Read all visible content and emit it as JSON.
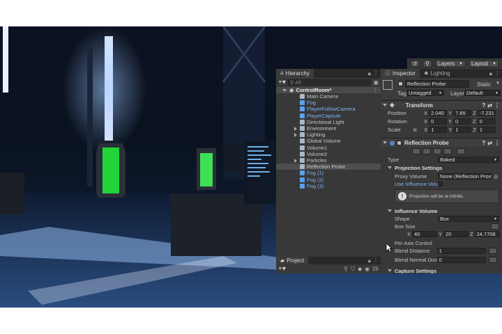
{
  "toolbar": {
    "layers_label": "Layers",
    "layout_label": "Layout"
  },
  "hierarchy": {
    "tab_label": "Hierarchy",
    "search_placeholder": "All",
    "scene_root": "ControlRoom*",
    "items": [
      {
        "label": "Main Camera",
        "prefab": false
      },
      {
        "label": "Fog",
        "prefab": true
      },
      {
        "label": "PlayerFollowCamera",
        "prefab": true
      },
      {
        "label": "PlayerCapsule",
        "prefab": true
      },
      {
        "label": "Directional Light",
        "prefab": false
      },
      {
        "label": "Environment",
        "prefab": false
      },
      {
        "label": "Lighting",
        "prefab": false
      },
      {
        "label": "Global Volume",
        "prefab": false
      },
      {
        "label": "Volume1",
        "prefab": false
      },
      {
        "label": "Volume2",
        "prefab": false
      },
      {
        "label": "Particles",
        "prefab": false
      },
      {
        "label": "Reflection Probe",
        "prefab": false
      },
      {
        "label": "Fog (1)",
        "prefab": true
      },
      {
        "label": "Fog (2)",
        "prefab": true
      },
      {
        "label": "Fog (3)",
        "prefab": true
      }
    ]
  },
  "project": {
    "tab_label": "Project",
    "count": "26"
  },
  "inspector": {
    "tab_label": "Inspector",
    "lighting_tab_label": "Lighting",
    "object_name": "Reflection Probe",
    "static_label": "Static",
    "tag_label": "Tag",
    "tag_value": "Untagged",
    "layer_label": "Layer",
    "layer_value": "Default",
    "transform": {
      "title": "Transform",
      "position_label": "Position",
      "rotation_label": "Rotation",
      "scale_label": "Scale",
      "position": {
        "x": "2.040",
        "y": "7.85",
        "z": "-7.231"
      },
      "rotation": {
        "x": "0",
        "y": "0",
        "z": "0"
      },
      "scale": {
        "x": "1",
        "y": "1",
        "z": "1"
      }
    },
    "probe": {
      "title": "Reflection Probe",
      "type_label": "Type",
      "type_value": "Baked",
      "projection_settings": "Projection Settings",
      "proxy_volume_label": "Proxy Volume",
      "proxy_volume_value": "None (Reflection Proxy",
      "use_influence_label": "Use Influence Volu",
      "info_text": "Projection will be at infinite.",
      "influence_volume": "Influence Volume",
      "shape_label": "Shape",
      "shape_value": "Box",
      "box_size_label": "Box Size",
      "box_size": {
        "x": "40",
        "y": "20",
        "z": "24.7706"
      },
      "per_axis_label": "Per Axis Control",
      "blend_distance_label": "Blend Distance",
      "blend_distance_value": "1",
      "blend_normal_label": "Blend Normal Dista",
      "blend_normal_value": "0",
      "capture_settings": "Capture Settings"
    }
  }
}
